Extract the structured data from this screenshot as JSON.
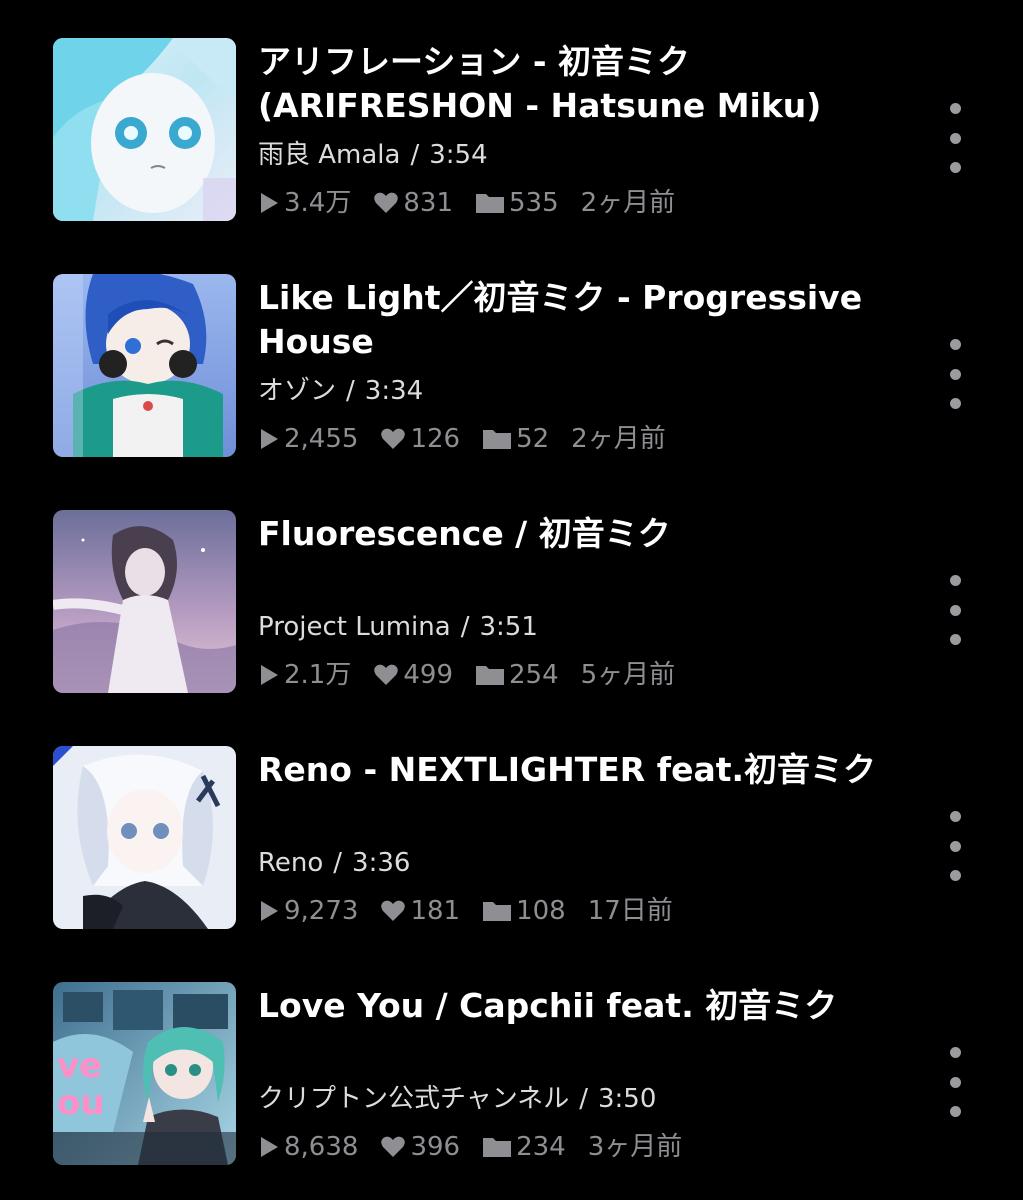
{
  "colors": {
    "background": "#000000",
    "title": "#ffffff",
    "meta": "#dcdcdc",
    "stats": "#8e8e93",
    "menu_dots": "#9a9a9f"
  },
  "icons": {
    "play": "play-icon",
    "like": "heart-icon",
    "mylist": "folder-icon",
    "more": "more-vertical-icon"
  },
  "videos": [
    {
      "title": "アリフレーション - 初音ミク (ARIFRESHON - Hatsune Miku)",
      "author": "雨良 Amala",
      "separator": "/",
      "duration": "3:54",
      "views": "3.4万",
      "likes": "831",
      "mylists": "535",
      "posted": "2ヶ月前"
    },
    {
      "title": "Like Light／初音ミク - Progressive House",
      "author": "オゾン",
      "separator": "/",
      "duration": "3:34",
      "views": "2,455",
      "likes": "126",
      "mylists": "52",
      "posted": "2ヶ月前"
    },
    {
      "title": "Fluorescence / 初音ミク",
      "author": "Project Lumina",
      "separator": "/",
      "duration": "3:51",
      "views": "2.1万",
      "likes": "499",
      "mylists": "254",
      "posted": "5ヶ月前"
    },
    {
      "title": "Reno - NEXTLIGHTER feat.初音ミク",
      "author": "Reno",
      "separator": "/",
      "duration": "3:36",
      "views": "9,273",
      "likes": "181",
      "mylists": "108",
      "posted": "17日前"
    },
    {
      "title": "Love You / Capchii feat. 初音ミク",
      "author": "クリプトン公式チャンネル",
      "separator": "/",
      "duration": "3:50",
      "views": "8,638",
      "likes": "396",
      "mylists": "234",
      "posted": "3ヶ月前"
    }
  ]
}
